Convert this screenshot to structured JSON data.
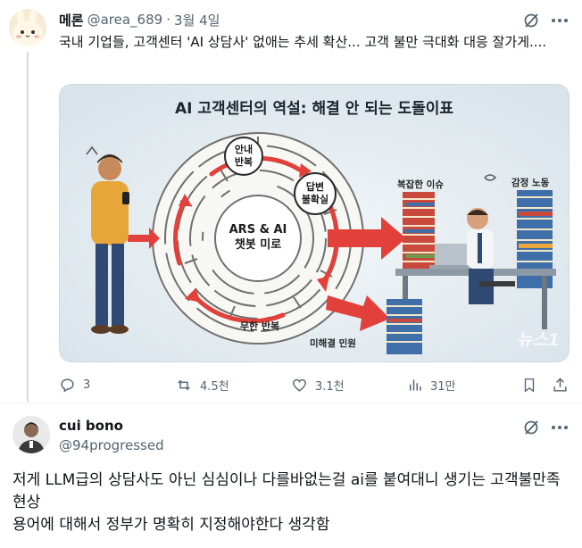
{
  "tweet": {
    "display_name": "메론",
    "handle": "@area_689",
    "separator": "·",
    "date": "3월 4일",
    "text": "국내 기업들, 고객센터 'AI 상담사' 없애는 추세 확산... 고객 불만 극대화 대응 잘가게....",
    "media": {
      "title": "AI 고객센터의 역설: 해결 안 되는 도돌이표",
      "maze_center": "ARS & AI\n챗봇 미로",
      "label_guide": "안내\n반복",
      "label_uncertain": "답변\n불확실",
      "label_loop": "무한 반복",
      "label_complex": "복잡한 이슈",
      "label_emotion": "감정 노동",
      "label_unresolved": "미해결 민원",
      "watermark": "뉴스1"
    },
    "actions": {
      "replies": "3",
      "reposts": "4.5천",
      "likes": "3.1천",
      "views": "31만"
    }
  },
  "reply": {
    "display_name": "cui bono",
    "handle": "@94progressed",
    "text_line1": "저게 LLM급의 상담사도 아닌 심심이나 다를바없는걸 ai를 붙여대니 생기는 고객불만족 현상",
    "text_line2": "용어에 대해서 정부가 명확히 지정해야한다 생각함"
  },
  "colors": {
    "text": "#0f1419",
    "secondary": "#536471",
    "border": "#cfd9de",
    "arrow_red": "#e2403a",
    "media_bg": "#e4ecf1"
  },
  "icons": [
    "grok-icon",
    "more-icon",
    "reply-icon",
    "repost-icon",
    "like-icon",
    "views-icon",
    "bookmark-icon",
    "share-icon"
  ]
}
